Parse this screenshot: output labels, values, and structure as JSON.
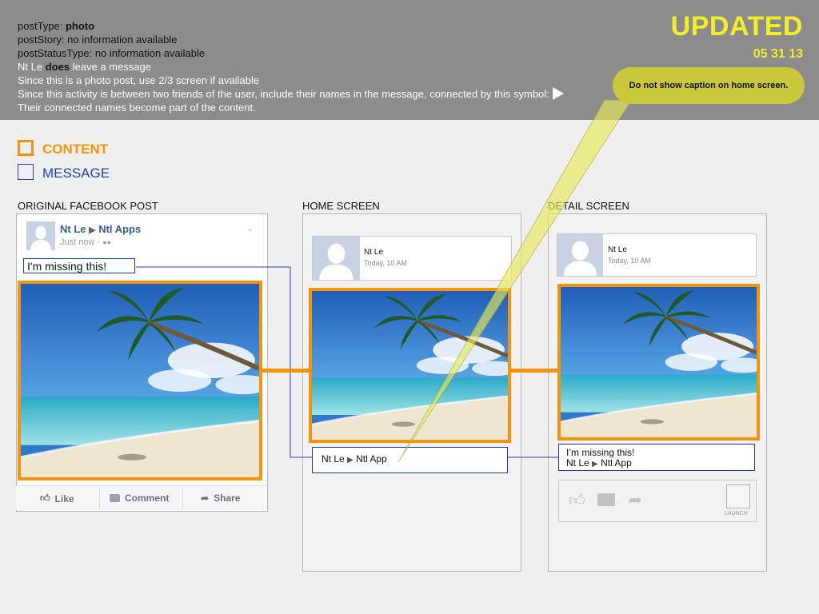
{
  "header": {
    "line1_prefix": "postType: ",
    "line1_value": "photo",
    "line2": "postStory: no information available",
    "line3": "postStatusType: no information available",
    "line4_a": "Nt Le ",
    "line4_b": "does",
    "line4_c": " leave a message",
    "line5": "Since this is a photo post, use 2/3 screen if available",
    "line6": "Since this activity is between two friends of the user, include their names in the message, connected by this symbol:",
    "line7": "Their connected names become part of the content.",
    "updated": "UPDATED",
    "date": "05 31 13",
    "callout": "Do not show caption on home screen."
  },
  "legend": {
    "content_label": "CONTENT",
    "message_label": "MESSAGE",
    "content_color": "#f5940a",
    "message_color": "#2342b0"
  },
  "sections": {
    "original": "ORIGINAL FACEBOOK POST",
    "home": "HOME SCREEN",
    "detail": "DETAIL SCREEN"
  },
  "fb_post": {
    "name_from": "Nt Le",
    "name_to": "Ntl Apps",
    "time": "Just now ·",
    "message": "I'm missing this!",
    "like": "Like",
    "comment": "Comment",
    "share": "Share"
  },
  "home": {
    "name": "Nt Le",
    "time": "Today, 10 AM",
    "caption_from": "Nt Le",
    "caption_to": "Ntl App"
  },
  "detail": {
    "name": "Nt Le",
    "time": "Today, 10 AM",
    "message": "I’m missing this!",
    "caption_from": "Nt Le",
    "caption_to": "Ntl App",
    "launch": "LAUNCH"
  },
  "icons": [
    "triangle-arrow-icon",
    "like-icon",
    "comment-icon",
    "share-icon",
    "friends-icon",
    "chevron-down-icon",
    "avatar-icon",
    "launch-icon"
  ]
}
